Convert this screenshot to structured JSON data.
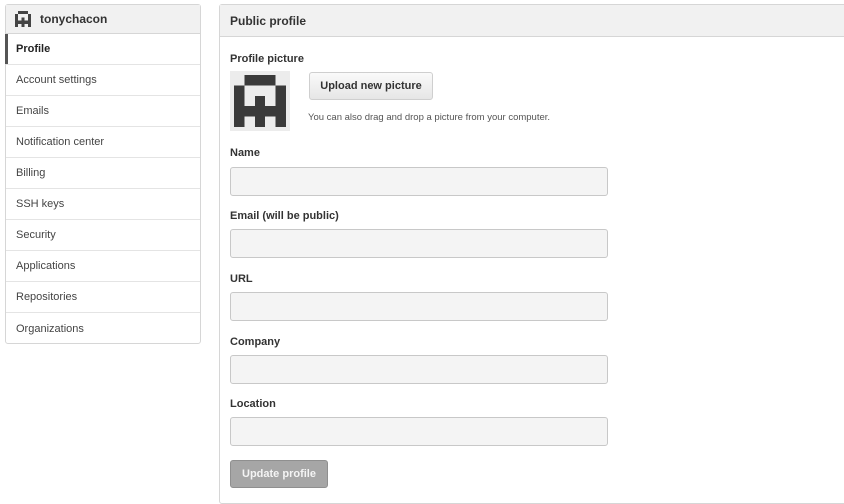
{
  "sidebar": {
    "username": "tonychacon",
    "items": [
      {
        "label": "Profile"
      },
      {
        "label": "Account settings"
      },
      {
        "label": "Emails"
      },
      {
        "label": "Notification center"
      },
      {
        "label": "Billing"
      },
      {
        "label": "SSH keys"
      },
      {
        "label": "Security"
      },
      {
        "label": "Applications"
      },
      {
        "label": "Repositories"
      },
      {
        "label": "Organizations"
      }
    ],
    "active_item": "Profile"
  },
  "main": {
    "title": "Public profile",
    "profile_picture": {
      "label": "Profile picture",
      "upload_button": "Upload new picture",
      "hint": "You can also drag and drop a picture from your computer."
    },
    "fields": [
      {
        "label": "Name",
        "value": "",
        "placeholder": ""
      },
      {
        "label": "Email (will be public)",
        "value": "",
        "placeholder": ""
      },
      {
        "label": "URL",
        "value": "",
        "placeholder": ""
      },
      {
        "label": "Company",
        "value": "",
        "placeholder": ""
      },
      {
        "label": "Location",
        "value": "",
        "placeholder": ""
      }
    ],
    "update_button": "Update profile"
  },
  "colors": {
    "header_bg": "#f1f1f1",
    "border": "#d6d6d6",
    "active_marker": "#555555",
    "disabled_button": "#a6a6a6"
  },
  "icons": {
    "user_avatar": "identicon"
  }
}
